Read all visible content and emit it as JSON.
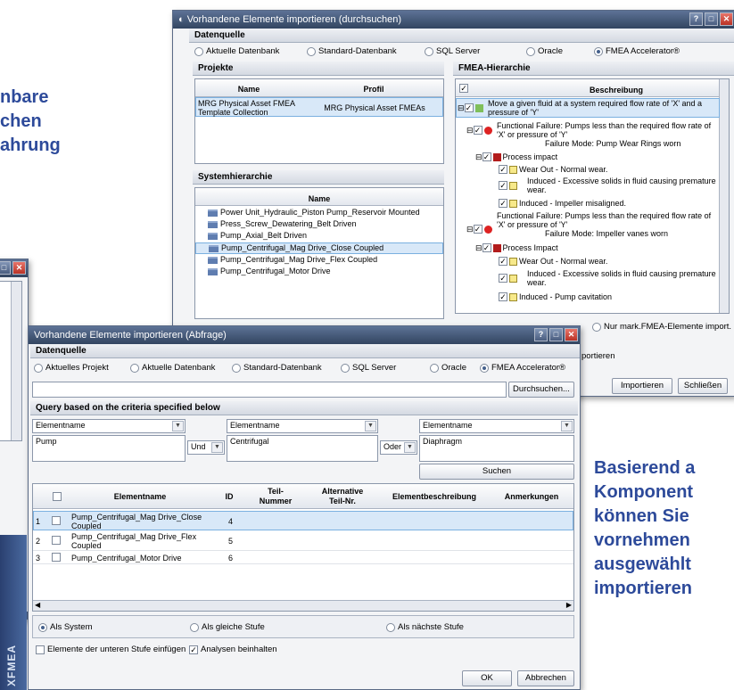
{
  "bg_text": {
    "left_lines": [
      "nbare",
      "chen",
      "ahrung"
    ],
    "right_lines": [
      "Basierend a",
      "Komponent",
      "können Sie",
      "vornehmen",
      "ausgewählt",
      "importieren"
    ]
  },
  "back_window": {
    "title": "Vorhandene Elemente importieren (durchsuchen)",
    "datasource_label": "Datenquelle",
    "datasources": [
      "Aktuelle Datenbank",
      "Standard-Datenbank",
      "SQL Server",
      "Oracle",
      "FMEA Accelerator®"
    ],
    "projects_label": "Projekte",
    "projects_cols": [
      "Name",
      "Profil"
    ],
    "project_rows": [
      {
        "name": "MRG Physical Asset FMEA Template Collection",
        "profile": "MRG Physical Asset FMEAs"
      }
    ],
    "system_label": "Systemhierarchie",
    "system_col": "Name",
    "system_items": [
      "Power Unit_Hydraulic_Piston Pump_Reservoir Mounted",
      "Press_Screw_Dewatering_Belt Driven",
      "Pump_Axial_Belt Driven",
      "Pump_Centrifugal_Mag Drive_Close Coupled",
      "Pump_Centrifugal_Mag Drive_Flex Coupled",
      "Pump_Centrifugal_Motor Drive"
    ],
    "fmea_label": "FMEA-Hierarchie",
    "fmea_col": "Beschreibung",
    "fmea_nodes": [
      "Move a given fluid at a system required flow rate of  'X' and a",
      "pressure of  'Y'",
      "Functional Failure: Pumps less than the required flow rate of",
      "'X' or pressure of  'Y'",
      "Failure Mode: Pump Wear Rings worn",
      "Process impact",
      "Wear Out - Normal wear.",
      "Induced - Excessive solids in fluid causing premature",
      "wear.",
      "Induced - Impeller misaligned.",
      "Functional Failure: Pumps less than the required flow rate of",
      "'X' or pressure of  'Y'",
      "Failure Mode: Impeller vanes worn",
      "Process Impact",
      "Wear Out - Normal wear.",
      "Induced - Excessive solids in fluid causing premature",
      "wear.",
      "Induced - Pump cavitation"
    ],
    "radio_nur": "Nur mark.FMEA-Elemente import.",
    "ortieren": "portieren",
    "btn_import": "Importieren",
    "btn_close": "Schließen"
  },
  "front_window": {
    "title": "Vorhandene Elemente importieren (Abfrage)",
    "datasource_label": "Datenquelle",
    "datasources": [
      "Aktuelles Projekt",
      "Aktuelle Datenbank",
      "Standard-Datenbank",
      "SQL Server",
      "Oracle",
      "FMEA Accelerator®"
    ],
    "browse_btn": "Durchsuchen...",
    "query_label": "Query based on the criteria specified below",
    "criteria": [
      {
        "field": "Elementname",
        "value": "Pump"
      },
      {
        "field": "Elementname",
        "value": "Centrifugal"
      },
      {
        "field": "Elementname",
        "value": "Diaphragm"
      }
    ],
    "op1": "Und",
    "op2": "Oder",
    "search_btn": "Suchen",
    "table_headers": [
      "Elementname",
      "ID",
      "Teil-\nNummer",
      "Alternative\nTeil-Nr.",
      "Elementbeschreibung",
      "Anmerkungen"
    ],
    "rows": [
      {
        "n": "1",
        "name": "Pump_Centrifugal_Mag Drive_Close Coupled",
        "id": "4"
      },
      {
        "n": "2",
        "name": "Pump_Centrifugal_Mag Drive_Flex Coupled",
        "id": "5"
      },
      {
        "n": "3",
        "name": "Pump_Centrifugal_Motor Drive",
        "id": "6"
      }
    ],
    "import_opts": [
      "Als System",
      "Als gleiche Stufe",
      "Als nächste Stufe"
    ],
    "chk_lower": "Elemente der unteren Stufe einfügen",
    "chk_analysis": "Analysen beinhalten",
    "ok": "OK",
    "cancel": "Abbrechen",
    "brand": "XFMEA"
  }
}
